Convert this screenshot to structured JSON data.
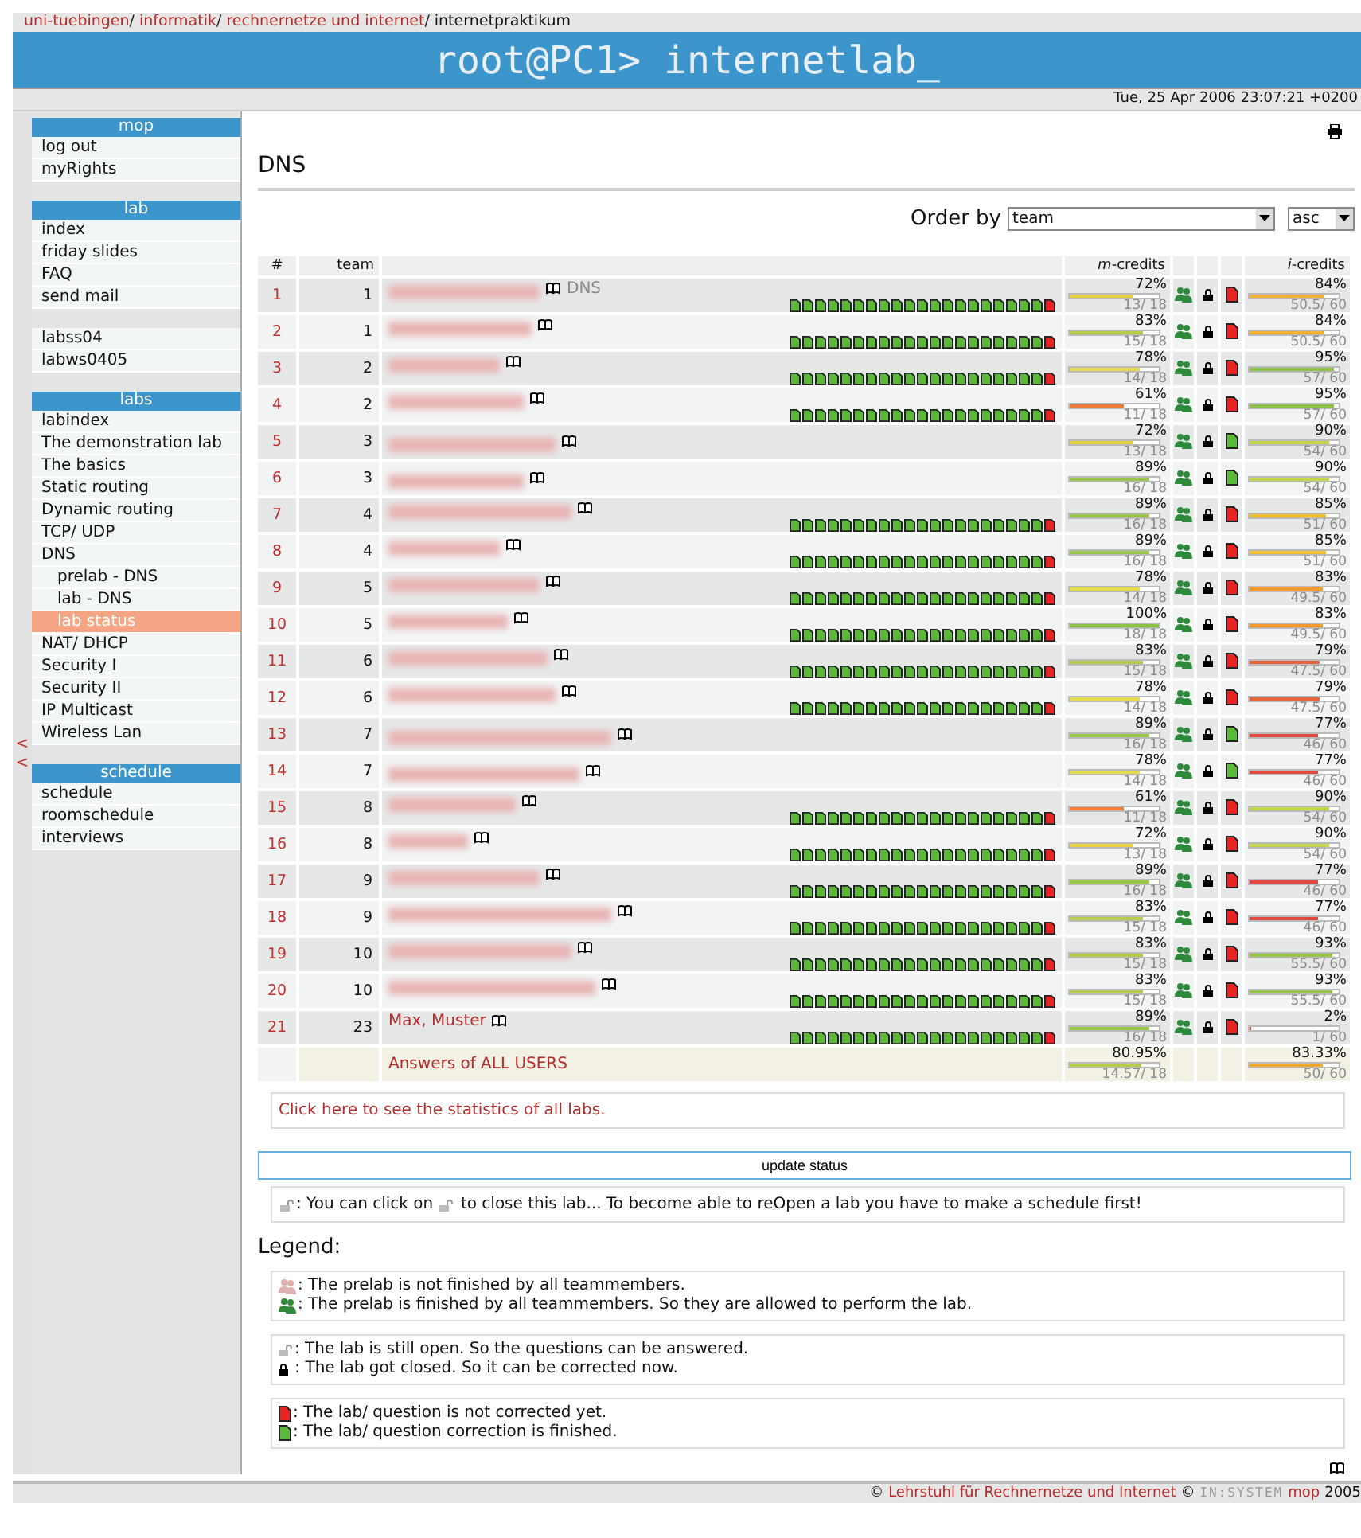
{
  "breadcrumb": [
    {
      "label": "uni-tuebingen",
      "sep": "/",
      "link": true
    },
    {
      "label": "informatik",
      "sep": "/",
      "link": true
    },
    {
      "label": "rechnernetze und internet",
      "sep": "/",
      "link": true
    },
    {
      "label": "internetpraktikum",
      "link": false
    }
  ],
  "banner": "root@PC1> internetlab_",
  "datetime": "Tue, 25 Apr 2006 23:07:21 +0200",
  "collapse_arrows": [
    "<",
    "<"
  ],
  "sidebar": [
    {
      "header": "mop",
      "items": [
        {
          "label": "log out",
          "selected": false
        },
        {
          "label": "myRights",
          "selected": false
        }
      ]
    },
    {
      "header": "lab",
      "items": [
        {
          "label": "index",
          "selected": false
        },
        {
          "label": "friday slides",
          "selected": false
        },
        {
          "label": "FAQ",
          "selected": false
        },
        {
          "label": "send mail",
          "selected": false
        }
      ]
    },
    {
      "items": [
        {
          "label": "labss04",
          "selected": false
        },
        {
          "label": "labws0405",
          "selected": false
        }
      ]
    },
    {
      "header": "labs",
      "items": [
        {
          "label": "labindex",
          "selected": false
        },
        {
          "label": "The demonstration lab",
          "selected": false
        },
        {
          "label": "The basics",
          "selected": false
        },
        {
          "label": "Static routing",
          "selected": false
        },
        {
          "label": "Dynamic routing",
          "selected": false
        },
        {
          "label": "TCP/ UDP",
          "selected": false
        },
        {
          "label": "DNS",
          "selected": false,
          "children": [
            {
              "label": "prelab - DNS",
              "selected": false
            },
            {
              "label": "lab - DNS",
              "selected": false
            },
            {
              "label": "lab status",
              "selected": true
            }
          ]
        },
        {
          "label": "NAT/ DHCP",
          "selected": false
        },
        {
          "label": "Security I",
          "selected": false
        },
        {
          "label": "Security II",
          "selected": false
        },
        {
          "label": "IP Multicast",
          "selected": false
        },
        {
          "label": "Wireless Lan",
          "selected": false
        }
      ]
    },
    {
      "header": "schedule",
      "items": [
        {
          "label": "schedule",
          "selected": false
        },
        {
          "label": "roomschedule",
          "selected": false
        },
        {
          "label": "interviews",
          "selected": false
        }
      ]
    }
  ],
  "title": "DNS",
  "order": {
    "label": "Order by",
    "field": "team",
    "direction": "asc"
  },
  "table": {
    "columns": [
      "#",
      "team",
      "",
      "*m*-credits",
      "",
      "",
      "",
      "*i*-credits"
    ],
    "rows": [
      {
        "num": "1",
        "team": "1",
        "name_hidden": true,
        "note": "DNS",
        "questions": [
          true,
          true,
          true,
          true,
          true,
          true,
          true,
          true,
          true,
          true,
          true,
          true,
          true,
          true,
          true,
          true,
          true,
          true,
          true,
          true,
          false
        ],
        "m": {
          "pct": "72%",
          "level": 0.72,
          "score": "13/ 18",
          "color": "#e8cf3c"
        },
        "prelab_done": true,
        "closed": true,
        "corrected": false,
        "i": {
          "pct": "84%",
          "level": 0.84,
          "score": "50.5/ 60",
          "color": "#f0b232"
        }
      },
      {
        "num": "2",
        "team": "1",
        "name_hidden": true,
        "questions": [
          true,
          true,
          true,
          true,
          true,
          true,
          true,
          true,
          true,
          true,
          true,
          true,
          true,
          true,
          true,
          true,
          true,
          true,
          true,
          true,
          false
        ],
        "m": {
          "pct": "83%",
          "level": 0.83,
          "score": "15/ 18",
          "color": "#b4cc4c"
        },
        "prelab_done": true,
        "closed": true,
        "corrected": false,
        "i": {
          "pct": "84%",
          "level": 0.84,
          "score": "50.5/ 60",
          "color": "#f0b232"
        }
      },
      {
        "num": "3",
        "team": "2",
        "name_hidden": true,
        "questions": [
          true,
          true,
          true,
          true,
          true,
          true,
          true,
          true,
          true,
          true,
          true,
          true,
          true,
          true,
          true,
          true,
          true,
          true,
          true,
          true,
          false
        ],
        "m": {
          "pct": "78%",
          "level": 0.78,
          "score": "14/ 18",
          "color": "#e4dc4c"
        },
        "prelab_done": true,
        "closed": true,
        "corrected": false,
        "i": {
          "pct": "95%",
          "level": 0.95,
          "score": "57/ 60",
          "color": "#8cc048"
        }
      },
      {
        "num": "4",
        "team": "2",
        "name_hidden": true,
        "questions": [
          true,
          true,
          true,
          true,
          true,
          true,
          true,
          true,
          true,
          true,
          true,
          true,
          true,
          true,
          true,
          true,
          true,
          true,
          true,
          true,
          false
        ],
        "m": {
          "pct": "61%",
          "level": 0.61,
          "score": "11/ 18",
          "color": "#ee7a3c"
        },
        "prelab_done": true,
        "closed": true,
        "corrected": false,
        "i": {
          "pct": "95%",
          "level": 0.95,
          "score": "57/ 60",
          "color": "#8cc048"
        }
      },
      {
        "num": "5",
        "team": "3",
        "name_hidden": true,
        "m": {
          "pct": "72%",
          "level": 0.72,
          "score": "13/ 18",
          "color": "#e8cf3c"
        },
        "prelab_done": true,
        "closed": true,
        "corrected": true,
        "i": {
          "pct": "90%",
          "level": 0.9,
          "score": "54/ 60",
          "color": "#c4d44c"
        }
      },
      {
        "num": "6",
        "team": "3",
        "name_hidden": true,
        "m": {
          "pct": "89%",
          "level": 0.89,
          "score": "16/ 18",
          "color": "#98c44a"
        },
        "prelab_done": true,
        "closed": true,
        "corrected": true,
        "i": {
          "pct": "90%",
          "level": 0.9,
          "score": "54/ 60",
          "color": "#c4d44c"
        }
      },
      {
        "num": "7",
        "team": "4",
        "name_hidden": true,
        "questions": [
          true,
          true,
          true,
          true,
          true,
          true,
          true,
          true,
          true,
          true,
          true,
          true,
          true,
          true,
          true,
          true,
          true,
          true,
          true,
          true,
          false
        ],
        "m": {
          "pct": "89%",
          "level": 0.89,
          "score": "16/ 18",
          "color": "#98c44a"
        },
        "prelab_done": true,
        "closed": true,
        "corrected": false,
        "i": {
          "pct": "85%",
          "level": 0.85,
          "score": "51/ 60",
          "color": "#f0c030"
        }
      },
      {
        "num": "8",
        "team": "4",
        "name_hidden": true,
        "questions": [
          true,
          true,
          true,
          true,
          true,
          true,
          true,
          true,
          true,
          true,
          true,
          true,
          true,
          true,
          true,
          true,
          true,
          true,
          true,
          true,
          false
        ],
        "m": {
          "pct": "89%",
          "level": 0.89,
          "score": "16/ 18",
          "color": "#98c44a"
        },
        "prelab_done": true,
        "closed": true,
        "corrected": false,
        "i": {
          "pct": "85%",
          "level": 0.85,
          "score": "51/ 60",
          "color": "#f0c030"
        }
      },
      {
        "num": "9",
        "team": "5",
        "name_hidden": true,
        "questions": [
          true,
          true,
          true,
          true,
          true,
          true,
          true,
          true,
          true,
          true,
          true,
          true,
          true,
          true,
          true,
          true,
          true,
          true,
          true,
          true,
          false
        ],
        "m": {
          "pct": "78%",
          "level": 0.78,
          "score": "14/ 18",
          "color": "#e4dc4c"
        },
        "prelab_done": true,
        "closed": true,
        "corrected": false,
        "i": {
          "pct": "83%",
          "level": 0.83,
          "score": "49.5/ 60",
          "color": "#f09a30"
        }
      },
      {
        "num": "10",
        "team": "5",
        "name_hidden": true,
        "questions": [
          true,
          true,
          true,
          true,
          true,
          true,
          true,
          true,
          true,
          true,
          true,
          true,
          true,
          true,
          true,
          true,
          true,
          true,
          true,
          true,
          false
        ],
        "m": {
          "pct": "100%",
          "level": 1,
          "score": "18/ 18",
          "color": "#8cc048"
        },
        "prelab_done": true,
        "closed": true,
        "corrected": false,
        "i": {
          "pct": "83%",
          "level": 0.83,
          "score": "49.5/ 60",
          "color": "#f09a30"
        }
      },
      {
        "num": "11",
        "team": "6",
        "name_hidden": true,
        "questions": [
          true,
          true,
          true,
          true,
          true,
          true,
          true,
          true,
          true,
          true,
          true,
          true,
          true,
          true,
          true,
          true,
          true,
          true,
          true,
          true,
          false
        ],
        "m": {
          "pct": "83%",
          "level": 0.83,
          "score": "15/ 18",
          "color": "#b4cc4c"
        },
        "prelab_done": true,
        "closed": true,
        "corrected": false,
        "i": {
          "pct": "79%",
          "level": 0.79,
          "score": "47.5/ 60",
          "color": "#e8643c"
        }
      },
      {
        "num": "12",
        "team": "6",
        "name_hidden": true,
        "questions": [
          true,
          true,
          true,
          true,
          true,
          true,
          true,
          true,
          true,
          true,
          true,
          true,
          true,
          true,
          true,
          true,
          true,
          true,
          true,
          true,
          false
        ],
        "m": {
          "pct": "78%",
          "level": 0.78,
          "score": "14/ 18",
          "color": "#e4dc4c"
        },
        "prelab_done": true,
        "closed": true,
        "corrected": false,
        "i": {
          "pct": "79%",
          "level": 0.79,
          "score": "47.5/ 60",
          "color": "#e8643c"
        }
      },
      {
        "num": "13",
        "team": "7",
        "name_hidden": true,
        "m": {
          "pct": "89%",
          "level": 0.89,
          "score": "16/ 18",
          "color": "#98c44a"
        },
        "prelab_done": true,
        "closed": true,
        "corrected": true,
        "i": {
          "pct": "77%",
          "level": 0.77,
          "score": "46/ 60",
          "color": "#e04840"
        }
      },
      {
        "num": "14",
        "team": "7",
        "name_hidden": true,
        "m": {
          "pct": "78%",
          "level": 0.78,
          "score": "14/ 18",
          "color": "#e4dc4c"
        },
        "prelab_done": true,
        "closed": true,
        "corrected": true,
        "i": {
          "pct": "77%",
          "level": 0.77,
          "score": "46/ 60",
          "color": "#e04840"
        }
      },
      {
        "num": "15",
        "team": "8",
        "name_hidden": true,
        "questions": [
          true,
          true,
          true,
          true,
          true,
          true,
          true,
          true,
          true,
          true,
          true,
          true,
          true,
          true,
          true,
          true,
          true,
          true,
          true,
          true,
          false
        ],
        "m": {
          "pct": "61%",
          "level": 0.61,
          "score": "11/ 18",
          "color": "#ee7a3c"
        },
        "prelab_done": true,
        "closed": true,
        "corrected": false,
        "i": {
          "pct": "90%",
          "level": 0.9,
          "score": "54/ 60",
          "color": "#c4d44c"
        }
      },
      {
        "num": "16",
        "team": "8",
        "name_hidden": true,
        "questions": [
          true,
          true,
          true,
          true,
          true,
          true,
          true,
          true,
          true,
          true,
          true,
          true,
          true,
          true,
          true,
          true,
          true,
          true,
          true,
          true,
          false
        ],
        "m": {
          "pct": "72%",
          "level": 0.72,
          "score": "13/ 18",
          "color": "#e8cf3c"
        },
        "prelab_done": true,
        "closed": true,
        "corrected": false,
        "i": {
          "pct": "90%",
          "level": 0.9,
          "score": "54/ 60",
          "color": "#c4d44c"
        }
      },
      {
        "num": "17",
        "team": "9",
        "name_hidden": true,
        "questions": [
          true,
          true,
          true,
          true,
          true,
          true,
          true,
          true,
          true,
          true,
          true,
          true,
          true,
          true,
          true,
          true,
          true,
          true,
          true,
          true,
          false
        ],
        "m": {
          "pct": "89%",
          "level": 0.89,
          "score": "16/ 18",
          "color": "#98c44a"
        },
        "prelab_done": true,
        "closed": true,
        "corrected": false,
        "i": {
          "pct": "77%",
          "level": 0.77,
          "score": "46/ 60",
          "color": "#e04840"
        }
      },
      {
        "num": "18",
        "team": "9",
        "name_hidden": true,
        "questions": [
          true,
          true,
          true,
          true,
          true,
          true,
          true,
          true,
          true,
          true,
          true,
          true,
          true,
          true,
          true,
          true,
          true,
          true,
          true,
          true,
          false
        ],
        "m": {
          "pct": "83%",
          "level": 0.83,
          "score": "15/ 18",
          "color": "#b4cc4c"
        },
        "prelab_done": true,
        "closed": true,
        "corrected": false,
        "i": {
          "pct": "77%",
          "level": 0.77,
          "score": "46/ 60",
          "color": "#e04840"
        }
      },
      {
        "num": "19",
        "team": "10",
        "name_hidden": true,
        "questions": [
          true,
          true,
          true,
          true,
          true,
          true,
          true,
          true,
          true,
          true,
          true,
          true,
          true,
          true,
          true,
          true,
          true,
          true,
          true,
          true,
          false
        ],
        "m": {
          "pct": "83%",
          "level": 0.83,
          "score": "15/ 18",
          "color": "#b4cc4c"
        },
        "prelab_done": true,
        "closed": true,
        "corrected": false,
        "i": {
          "pct": "93%",
          "level": 0.93,
          "score": "55.5/ 60",
          "color": "#98c44a"
        }
      },
      {
        "num": "20",
        "team": "10",
        "name_hidden": true,
        "questions": [
          true,
          true,
          true,
          true,
          true,
          true,
          true,
          true,
          true,
          true,
          true,
          true,
          true,
          true,
          true,
          true,
          true,
          true,
          true,
          true,
          false
        ],
        "m": {
          "pct": "83%",
          "level": 0.83,
          "score": "15/ 18",
          "color": "#b4cc4c"
        },
        "prelab_done": true,
        "closed": true,
        "corrected": false,
        "i": {
          "pct": "93%",
          "level": 0.93,
          "score": "55.5/ 60",
          "color": "#98c44a"
        }
      },
      {
        "num": "21",
        "team": "23",
        "name": "Max, Muster",
        "questions": [
          true,
          true,
          true,
          true,
          true,
          true,
          true,
          true,
          true,
          true,
          true,
          true,
          true,
          true,
          true,
          true,
          true,
          true,
          true,
          true,
          false
        ],
        "m": {
          "pct": "89%",
          "level": 0.89,
          "score": "16/ 18",
          "color": "#98c44a"
        },
        "prelab_done": true,
        "closed": true,
        "corrected": false,
        "i": {
          "pct": "2%",
          "level": 0.02,
          "score": "1/ 60",
          "color": "#e04040"
        }
      }
    ],
    "summary": {
      "label": "Answers of ALL USERS",
      "m": {
        "pct": "80.95%",
        "level": 0.81,
        "score": "14.57/ 18",
        "color": "#b4cc4c"
      },
      "i": {
        "pct": "83.33%",
        "level": 0.83,
        "score": "50/ 60",
        "color": "#f0a832"
      }
    }
  },
  "stats_link": "Click here to see the statistics of all labs.",
  "update_button": "update status",
  "close_hint": [
    {
      "kind": "open_lock"
    },
    {
      "kind": "text",
      "text": ": You can click on "
    },
    {
      "kind": "open_lock"
    },
    {
      "kind": "text",
      "text": " to close this lab... To become able to reOpen a lab you have to make a schedule first!"
    }
  ],
  "legend_title": "Legend:",
  "legend": [
    [
      {
        "kind": "prelab_pending",
        "text": ": The prelab is not finished by all teammembers."
      },
      {
        "kind": "prelab_done",
        "text": ": The prelab is finished by all teammembers. So they are allowed to perform the lab."
      }
    ],
    [
      {
        "kind": "open_lock",
        "text": ": The lab is still open. So the questions can be answered."
      },
      {
        "kind": "closed_lock",
        "text": " : The lab got closed. So it can be corrected now."
      }
    ],
    [
      {
        "kind": "doc_red",
        "text": ": The lab/ question is not corrected yet."
      },
      {
        "kind": "doc_green",
        "text": ": The lab/ question correction is finished."
      }
    ]
  ],
  "footer": [
    {
      "text": "©",
      "link": false
    },
    {
      "text": "Lehrstuhl für Rechnernetze und Internet",
      "link": true
    },
    {
      "text": "©",
      "link": false
    },
    {
      "text": "IN:SYSTEM",
      "link": false,
      "logo": true
    },
    {
      "text": "mop",
      "link": true
    },
    {
      "text": "2005",
      "link": false
    }
  ]
}
